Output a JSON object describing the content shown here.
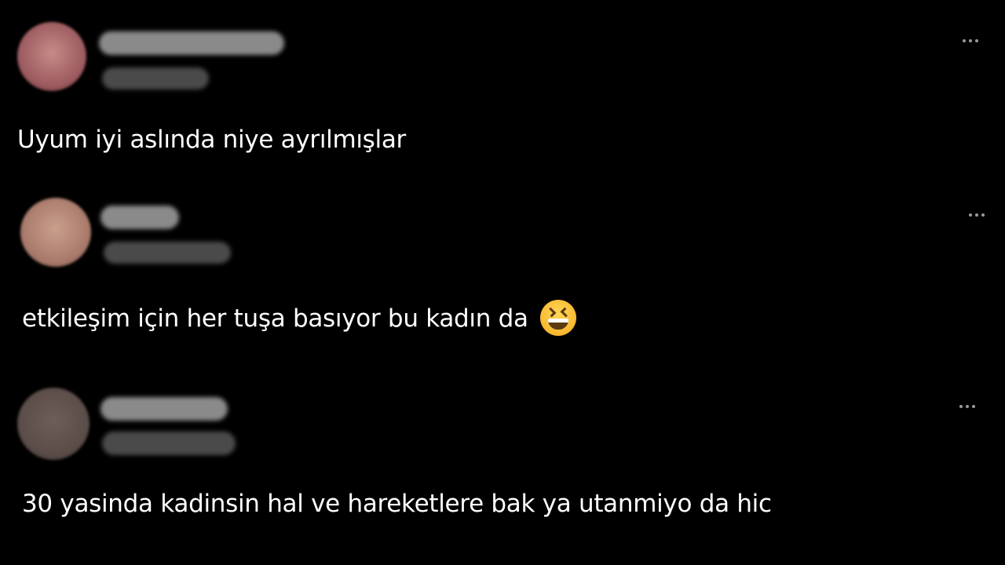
{
  "comments": [
    {
      "text": "Uyum iyi aslında niye ayrılmışlar",
      "avatar_color": "#9b5a5e",
      "more_icon": "more-horizontal-icon"
    },
    {
      "text": "etkileşim için her tuşa basıyor bu kadın da",
      "emoji": "laughing-face-icon",
      "avatar_color": "#a8796a",
      "more_icon": "more-horizontal-icon"
    },
    {
      "text": "30 yasinda kadinsin hal ve hareketlere bak ya utanmiyo da hic",
      "avatar_color": "#5a4c48",
      "more_icon": "more-horizontal-icon"
    }
  ],
  "colors": {
    "background": "#000000",
    "text": "#ffffff",
    "blur_name": "#8a8a8a",
    "blur_meta": "#4a4a4a",
    "icon": "#9a9a9a"
  }
}
